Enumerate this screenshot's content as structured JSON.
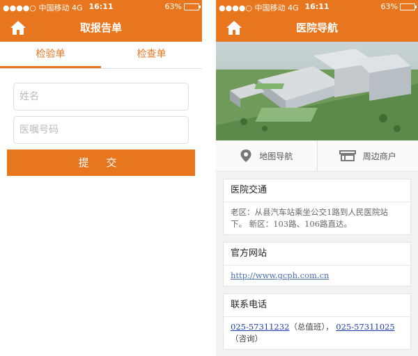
{
  "status_bar": {
    "carrier": "●●●●○ 中国移动  4G",
    "time": "16:11",
    "battery": "63%",
    "battery_level": 0.63
  },
  "left_screen": {
    "title": "取报告单",
    "tabs": [
      {
        "label": "检验单",
        "active": true
      },
      {
        "label": "检查单",
        "active": false
      }
    ],
    "form": {
      "name_placeholder": "姓名",
      "order_placeholder": "医嘱号码",
      "submit_label": "提 交"
    }
  },
  "right_screen": {
    "title": "医院导航",
    "actions": {
      "map_label": "地图导航",
      "nearby_label": "周边商户"
    },
    "transport": {
      "title": "医院交通",
      "text": "老区：从县汽车站乘坐公交1路到人民医院站下。 新区：103路、106路直达。"
    },
    "website": {
      "title": "官方网站",
      "url": "http://www.gcph.com.cn"
    },
    "contact": {
      "title": "联系电话",
      "phone1": "025-57311232",
      "phone1_note": "（总值班），",
      "phone2": "025-57311025",
      "phone2_note": "（咨询）"
    }
  },
  "colors": {
    "accent": "#e8761f"
  }
}
